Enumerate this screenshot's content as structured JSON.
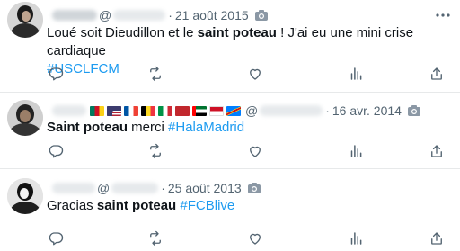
{
  "tweets": [
    {
      "date": "21 août 2015",
      "text_before": "Loué soit Dieudillon et le ",
      "text_bold": "saint poteau",
      "text_after": " ! J'ai eu une mini crise cardiaque ",
      "hashtag": "#USCLFCM"
    },
    {
      "date": "16 avr. 2014",
      "text_before": "",
      "text_bold": "Saint poteau",
      "text_after": " merci ",
      "hashtag": "#HalaMadrid"
    },
    {
      "date": "25 août 2013",
      "text_before": "Gracias ",
      "text_bold": "saint poteau",
      "text_after": " ",
      "hashtag": "#FCBlive"
    }
  ],
  "handle_prefix": "@",
  "separator": "·",
  "icons": {
    "more": "more-horizontal-icon",
    "reply": "reply-icon",
    "retweet": "retweet-icon",
    "like": "like-icon",
    "views": "views-icon",
    "share": "share-icon",
    "media": "camera-icon"
  },
  "colors": {
    "text": "#0f1419",
    "secondary": "#536471",
    "link": "#1d9bf0",
    "divider": "#e7e9ea"
  }
}
